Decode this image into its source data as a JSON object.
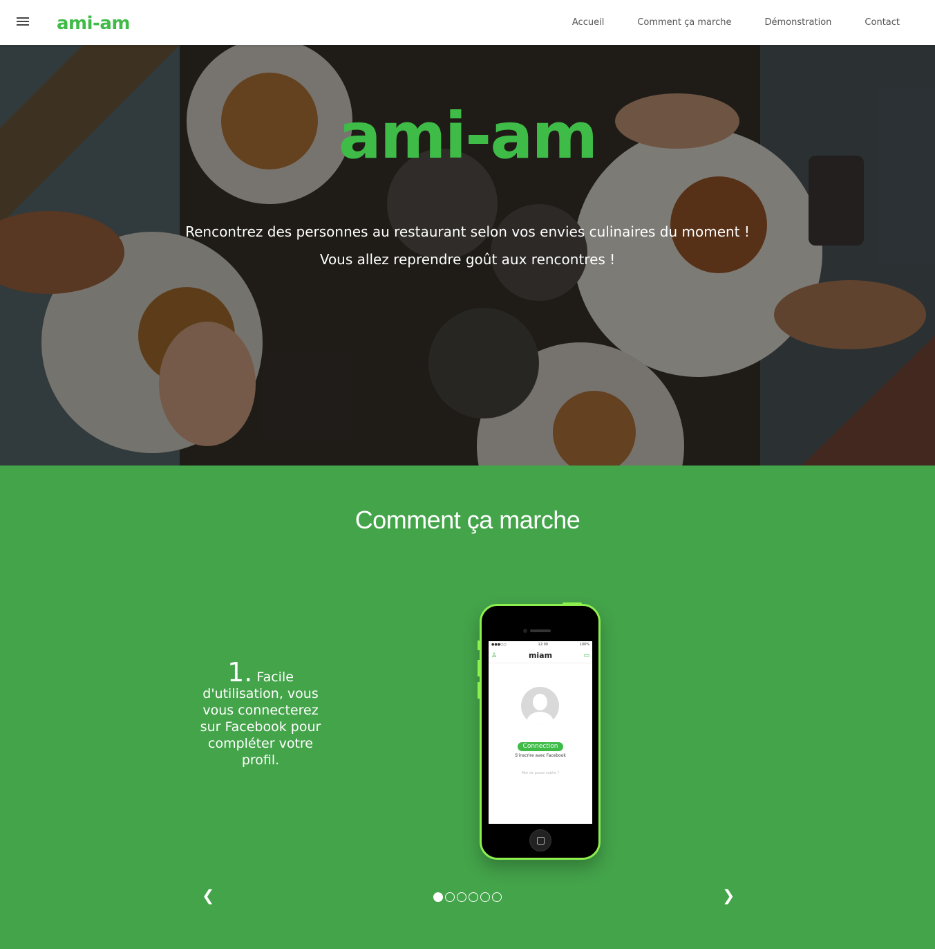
{
  "header": {
    "logo": "ami-am",
    "nav": [
      "Accueil",
      "Comment ça marche",
      "Démonstration",
      "Contact"
    ]
  },
  "hero": {
    "logo": "ami-am",
    "tagline1": "Rencontrez des personnes au restaurant selon vos envies culinaires du moment !",
    "tagline2": "Vous allez reprendre goût aux rencontres !"
  },
  "section": {
    "title": "Comment ça marche",
    "step_number": "1.",
    "step_text": "Facile d'utilisation, vous vous connecterez sur Facebook pour compléter votre profil.",
    "phone": {
      "time": "12:00",
      "battery": "100%",
      "app_title": "miam",
      "button": "Connection",
      "facebook": "S'inscrire avec Facebook",
      "forgot": "Mot de passe oublié ?"
    },
    "prev": "❮",
    "next": "❯",
    "slide_count": 6,
    "active_slide": 0
  },
  "colors": {
    "brand": "#3fbb47",
    "section_bg": "#44a44a",
    "phone_frame": "#8df04f"
  }
}
